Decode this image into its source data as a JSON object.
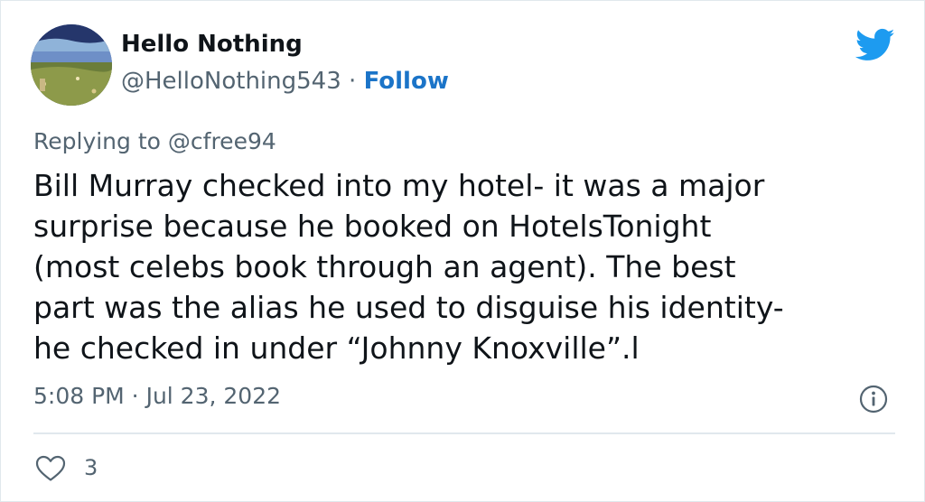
{
  "author": {
    "display_name": "Hello Nothing",
    "handle": "@HelloNothing543",
    "separator": "·",
    "follow_label": "Follow"
  },
  "reply": {
    "prefix": "Replying to",
    "mention": "@cfree94"
  },
  "tweet": {
    "lines": [
      "Bill Murray checked into my hotel- it was a major",
      "surprise because he booked on HotelsTonight",
      "(most celebs book through an agent). The best",
      "part was the alias he used to disguise his identity-",
      "he checked in under “Johnny Knoxville”.l"
    ]
  },
  "meta": {
    "timestamp": "5:08 PM · Jul 23, 2022"
  },
  "actions": {
    "like_count": "3"
  },
  "icons": {
    "brand": "twitter-bird-icon",
    "info": "info-icon",
    "like": "heart-icon"
  },
  "colors": {
    "brand_blue": "#1d9bf0",
    "follow_blue": "#1b74c8",
    "secondary_text": "#536471",
    "primary_text": "#0f1419",
    "divider": "#e1e8ed"
  }
}
